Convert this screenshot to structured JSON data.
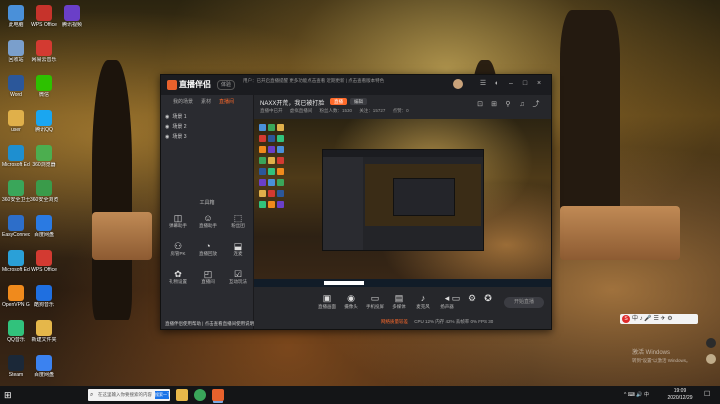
{
  "colors": {
    "accent": "#ff6a2a",
    "window_bg": "#232428",
    "taskbar_bg": "#141517"
  },
  "desktop": {
    "icons": [
      {
        "label": "此电脑",
        "color": "#4a90d9"
      },
      {
        "label": "回收站",
        "color": "#7a9fcc"
      },
      {
        "label": "Word",
        "color": "#2b579a"
      },
      {
        "label": "user",
        "color": "#e0b04a"
      },
      {
        "label": "Microsoft Edge",
        "color": "#1e8fd0"
      },
      {
        "label": "360安全卫士",
        "color": "#3aa65a"
      },
      {
        "label": "EasyConnect",
        "color": "#2d6ec9"
      },
      {
        "label": "Microsoft Edge",
        "color": "#2aa0d8"
      },
      {
        "label": "OpenVPN GUI",
        "color": "#f08a1c"
      },
      {
        "label": "QQ音乐",
        "color": "#31c27c"
      },
      {
        "label": "Steam",
        "color": "#1b2838"
      },
      {
        "label": "WPS Office",
        "color": "#c6332b"
      },
      {
        "label": "网易云音乐",
        "color": "#d33a31"
      },
      {
        "label": "微信",
        "color": "#2dc100"
      },
      {
        "label": "腾讯QQ",
        "color": "#1aa6f0"
      },
      {
        "label": "360浏览器",
        "color": "#4cae4f"
      },
      {
        "label": "360安全浏览器",
        "color": "#3a9b4a"
      },
      {
        "label": "百度网盘",
        "color": "#2a7ae2"
      },
      {
        "label": "WPS Office",
        "color": "#d33a31"
      },
      {
        "label": "酷狗音乐",
        "color": "#1f6fe0"
      },
      {
        "label": "新建文件夹",
        "color": "#e5b74a"
      },
      {
        "label": "百度网盘",
        "color": "#3b82f0"
      },
      {
        "label": "腾讯视频",
        "color": "#6a3fc8"
      }
    ]
  },
  "app": {
    "name": "直播伴侣",
    "version": "体验",
    "notice": "用户：已开启直播提醒 更多功能点击查看 近期更新 | 点击查看版本特色",
    "left_tabs": [
      "我的场景",
      "素材",
      "直播间"
    ],
    "scenes": [
      "场景 1",
      "场景 2",
      "场景 3"
    ],
    "tools_title": "工具箱",
    "tools": [
      {
        "label": "弹幕助手",
        "glyph": "◫"
      },
      {
        "label": "直播助手",
        "glyph": "☺"
      },
      {
        "label": "粉丝团",
        "glyph": "⬚"
      },
      {
        "label": "房管PK",
        "glyph": "⚇"
      },
      {
        "label": "直播回放",
        "glyph": "◔"
      },
      {
        "label": "连麦",
        "glyph": "⬓"
      },
      {
        "label": "礼物设置",
        "glyph": "✿"
      },
      {
        "label": "直播间",
        "glyph": "◰"
      },
      {
        "label": "互动玩法",
        "glyph": "☑"
      }
    ],
    "footer_text": "直播伴侣使用帮助 | 点击查看直播间使用说明",
    "room_title": "NAXX开荒，我已被打脸",
    "live_btn": "直播",
    "edit_btn": "编辑",
    "subinfo": [
      "直播中已开",
      "虚拟直播间",
      "粉丝人数：1530",
      "关注：15727",
      "点赞：0"
    ],
    "controls": [
      {
        "label": "直播画面",
        "glyph": "▣"
      },
      {
        "label": "摄像头",
        "glyph": "◉"
      },
      {
        "label": "手机投屏",
        "glyph": "▭"
      },
      {
        "label": "多媒体",
        "glyph": "▤"
      },
      {
        "label": "麦克风",
        "glyph": "♪"
      },
      {
        "label": "扬声器",
        "glyph": "◂"
      }
    ],
    "start_live": "开始直播",
    "bottom_warn": "网络质量较差",
    "bottom_stats": "CPU 12%  内存 42%  丢帧率 0%  FPS 30"
  },
  "ime": {
    "text": "中 ♪ 🎤 ☰ ✈ ⚙"
  },
  "watermark": {
    "line1": "激活 Windows",
    "line2": "转到“设置”以激活 Windows。"
  },
  "taskbar": {
    "search_placeholder": "在这里输入你要搜索的内容",
    "search_button": "搜索一下",
    "tray_text": "^ ⌨ 🔊 中",
    "time": "19:09",
    "date": "2020/12/29"
  }
}
